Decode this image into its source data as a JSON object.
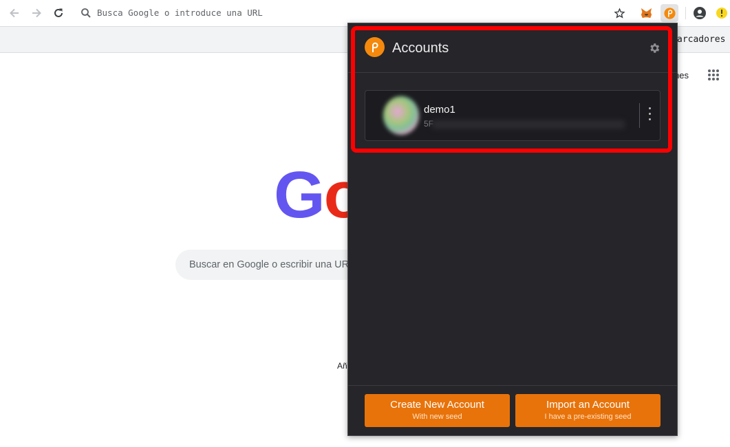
{
  "browser": {
    "omnibox_placeholder": "Busca Google o introduce una URL",
    "bookmarks_label": "arcadores"
  },
  "google": {
    "logo_letters": [
      "G",
      "o"
    ],
    "search_placeholder": "Buscar en Google o escribir una URL",
    "partial_header_text": "nes",
    "partial_shortcut_text": "Añ"
  },
  "popup": {
    "title": "Accounts",
    "account": {
      "name": "demo1",
      "address_prefix": "5F"
    },
    "buttons": {
      "create_label": "Create New Account",
      "create_sub": "With new seed",
      "import_label": "Import an Account",
      "import_sub": "I have a pre-existing seed"
    }
  },
  "colors": {
    "popup_bg": "#26252a",
    "accent_orange": "#e8730a",
    "highlight_red": "#ff0000"
  }
}
